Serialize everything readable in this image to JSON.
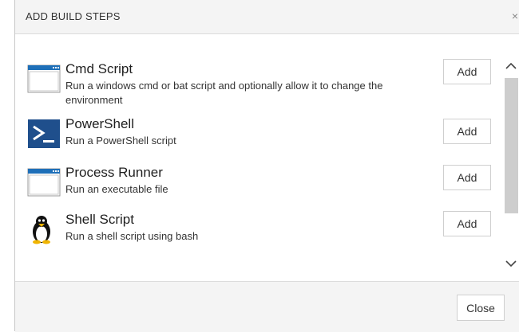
{
  "dialog": {
    "title": "ADD BUILD STEPS",
    "close_glyph": "×"
  },
  "steps": [
    {
      "name": "Cmd Script",
      "description": "Run a windows cmd or bat script and optionally allow it to change the environment",
      "icon": "window-icon",
      "add_label": "Add"
    },
    {
      "name": "PowerShell",
      "description": "Run a PowerShell script",
      "icon": "powershell-icon",
      "add_label": "Add"
    },
    {
      "name": "Process Runner",
      "description": "Run an executable file",
      "icon": "window-icon",
      "add_label": "Add"
    },
    {
      "name": "Shell Script",
      "description": "Run a shell script using bash",
      "icon": "penguin-icon",
      "add_label": "Add"
    }
  ],
  "footer": {
    "close_label": "Close"
  },
  "colors": {
    "header_bg": "#f4f4f4",
    "window_icon_blue": "#1e6fb8",
    "powershell_bg": "#1f4f8c",
    "scroll_thumb": "#cdcdcd"
  }
}
